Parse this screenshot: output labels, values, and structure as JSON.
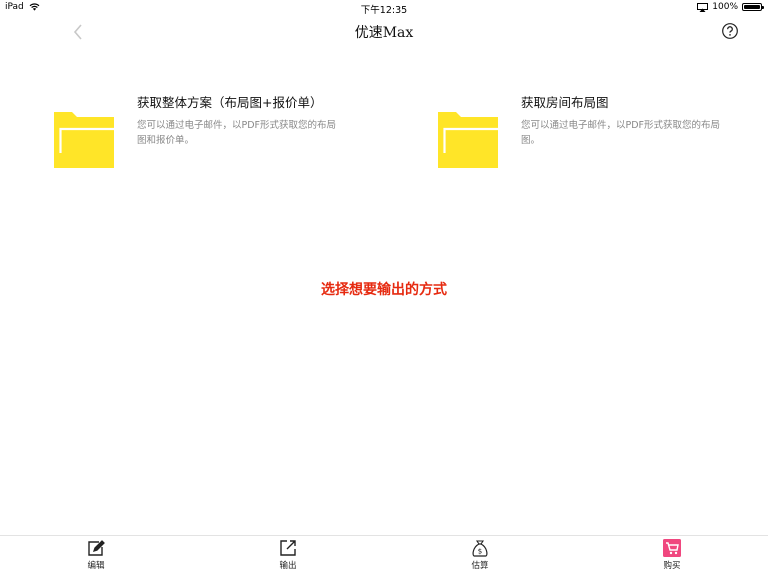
{
  "status_bar": {
    "device": "iPad",
    "time": "下午12:35",
    "battery": "100%",
    "battery_level": 1.0
  },
  "nav": {
    "title": "优速Max",
    "back_icon": "chevron-left-icon",
    "help_icon": "question-circle-icon"
  },
  "options": [
    {
      "title": "获取整体方案（布局图+报价单）",
      "description": "您可以通过电子邮件，以PDF形式获取您的布局图和报价单。",
      "icon": "folder-icon",
      "icon_color": "#FFE528"
    },
    {
      "title": "获取房间布局图",
      "description": "您可以通过电子邮件，以PDF形式获取您的布局图。",
      "icon": "folder-icon",
      "icon_color": "#FFE528"
    }
  ],
  "prompt": {
    "text": "选择想要输出的方式",
    "color": "#E62A10"
  },
  "tab_bar": {
    "tabs": [
      {
        "label": "编辑",
        "icon": "edit-icon"
      },
      {
        "label": "输出",
        "icon": "export-icon"
      },
      {
        "label": "估算",
        "icon": "money-bag-icon"
      },
      {
        "label": "购买",
        "icon": "cart-icon",
        "accent": "#F0477F"
      }
    ]
  }
}
